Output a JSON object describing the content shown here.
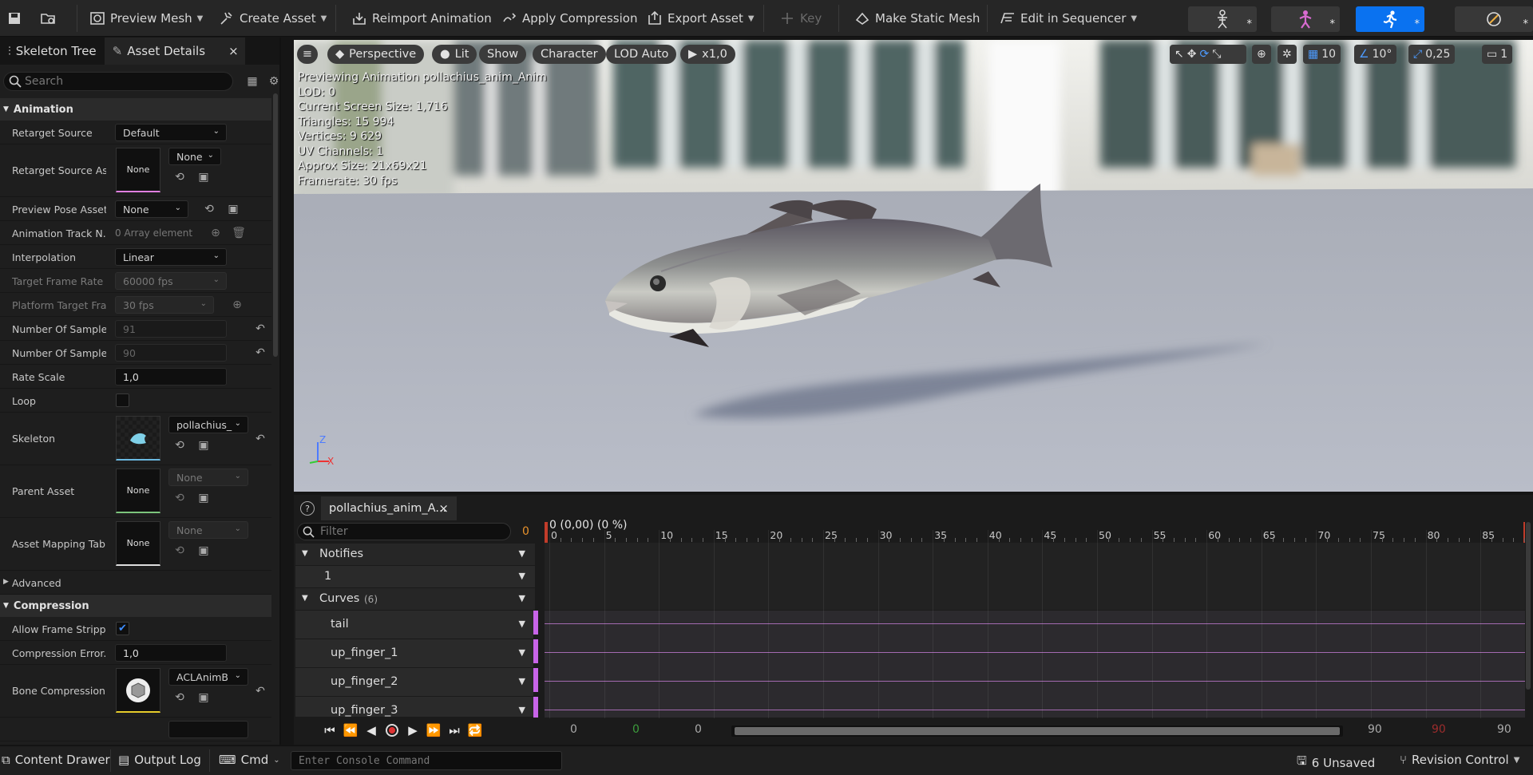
{
  "toolbar": {
    "items": [
      {
        "label": "Preview Mesh",
        "icon": "preview-mesh-icon"
      },
      {
        "label": "Create Asset",
        "icon": "create-asset-icon"
      },
      {
        "label": "Reimport Animation",
        "icon": "reimport-icon"
      },
      {
        "label": "Apply Compression",
        "icon": "compression-icon"
      },
      {
        "label": "Export Asset",
        "icon": "export-icon"
      },
      {
        "label": "Key",
        "icon": "key-plus-icon"
      },
      {
        "label": "Make Static Mesh",
        "icon": "static-mesh-icon"
      },
      {
        "label": "Edit in Sequencer",
        "icon": "sequencer-icon"
      }
    ],
    "mode_star": "*"
  },
  "left_panel": {
    "tabs": [
      "Skeleton Tree",
      "Asset Details"
    ],
    "search_placeholder": "Search",
    "categories": {
      "animation": "Animation",
      "advanced": "Advanced",
      "compression": "Compression"
    },
    "props": {
      "retarget_source": {
        "label": "Retarget Source",
        "value": "Default"
      },
      "retarget_source_asset": {
        "label": "Retarget Source As...",
        "thumb": "None",
        "value": "None"
      },
      "preview_pose_asset": {
        "label": "Preview Pose Asset",
        "value": "None"
      },
      "animation_track": {
        "label": "Animation Track N...",
        "value": "0 Array element"
      },
      "interpolation": {
        "label": "Interpolation",
        "value": "Linear"
      },
      "target_frame_rate": {
        "label": "Target Frame Rate",
        "value": "60000 fps"
      },
      "platform_target": {
        "label": "Platform Target Fra...",
        "value": "30 fps"
      },
      "num_samples_1": {
        "label": "Number Of Sample...",
        "value": "91"
      },
      "num_samples_2": {
        "label": "Number Of Sample...",
        "value": "90"
      },
      "rate_scale": {
        "label": "Rate Scale",
        "value": "1,0"
      },
      "loop": {
        "label": "Loop"
      },
      "skeleton": {
        "label": "Skeleton",
        "value": "pollachius_"
      },
      "parent_asset": {
        "label": "Parent Asset",
        "thumb": "None",
        "value": "None"
      },
      "asset_mapping": {
        "label": "Asset Mapping Table",
        "thumb": "None",
        "value": "None"
      },
      "allow_frame": {
        "label": "Allow Frame Strippi..."
      },
      "compression_error": {
        "label": "Compression Error...",
        "value": "1,0"
      },
      "bone_compression": {
        "label": "Bone Compression...",
        "value": "ACLAnimB"
      }
    }
  },
  "viewport": {
    "pills": [
      "Perspective",
      "Lit",
      "Show",
      "Character",
      "LOD Auto",
      "x1,0"
    ],
    "stats": [
      "Previewing Animation pollachius_anim_Anim",
      "LOD: 0",
      "Current Screen Size: 1,716",
      "Triangles: 15 994",
      "Vertices: 9 629",
      "UV Channels: 1",
      "Approx Size: 21x69x21",
      "Framerate: 30 fps"
    ],
    "grid_value": "10",
    "angle_value": "10°",
    "scale_value": "0,25",
    "camera_value": "1",
    "axis_z": "Z",
    "axis_x": "X"
  },
  "anim_panel": {
    "tab_label": "pollachius_anim_A...",
    "filter_placeholder": "Filter",
    "filter_count": "0",
    "time_readout": "0 (0,00) (0 %)",
    "notifies_label": "Notifies",
    "notify_track": "1",
    "curves_label": "Curves",
    "curves_count": "(6)",
    "curves": [
      "tail",
      "up_finger_1",
      "up_finger_2",
      "up_finger_3"
    ],
    "ticks": [
      "0",
      "5",
      "10",
      "15",
      "20",
      "25",
      "30",
      "35",
      "40",
      "45",
      "50",
      "55",
      "60",
      "65",
      "70",
      "75",
      "80",
      "85"
    ],
    "range_values": [
      "0",
      "0",
      "0",
      "90",
      "90",
      "90"
    ]
  },
  "status_bar": {
    "content_drawer": "Content Drawer",
    "output_log": "Output Log",
    "cmd": "Cmd",
    "console_placeholder": "Enter Console Command",
    "unsaved": "6 Unsaved",
    "revision_control": "Revision Control"
  }
}
